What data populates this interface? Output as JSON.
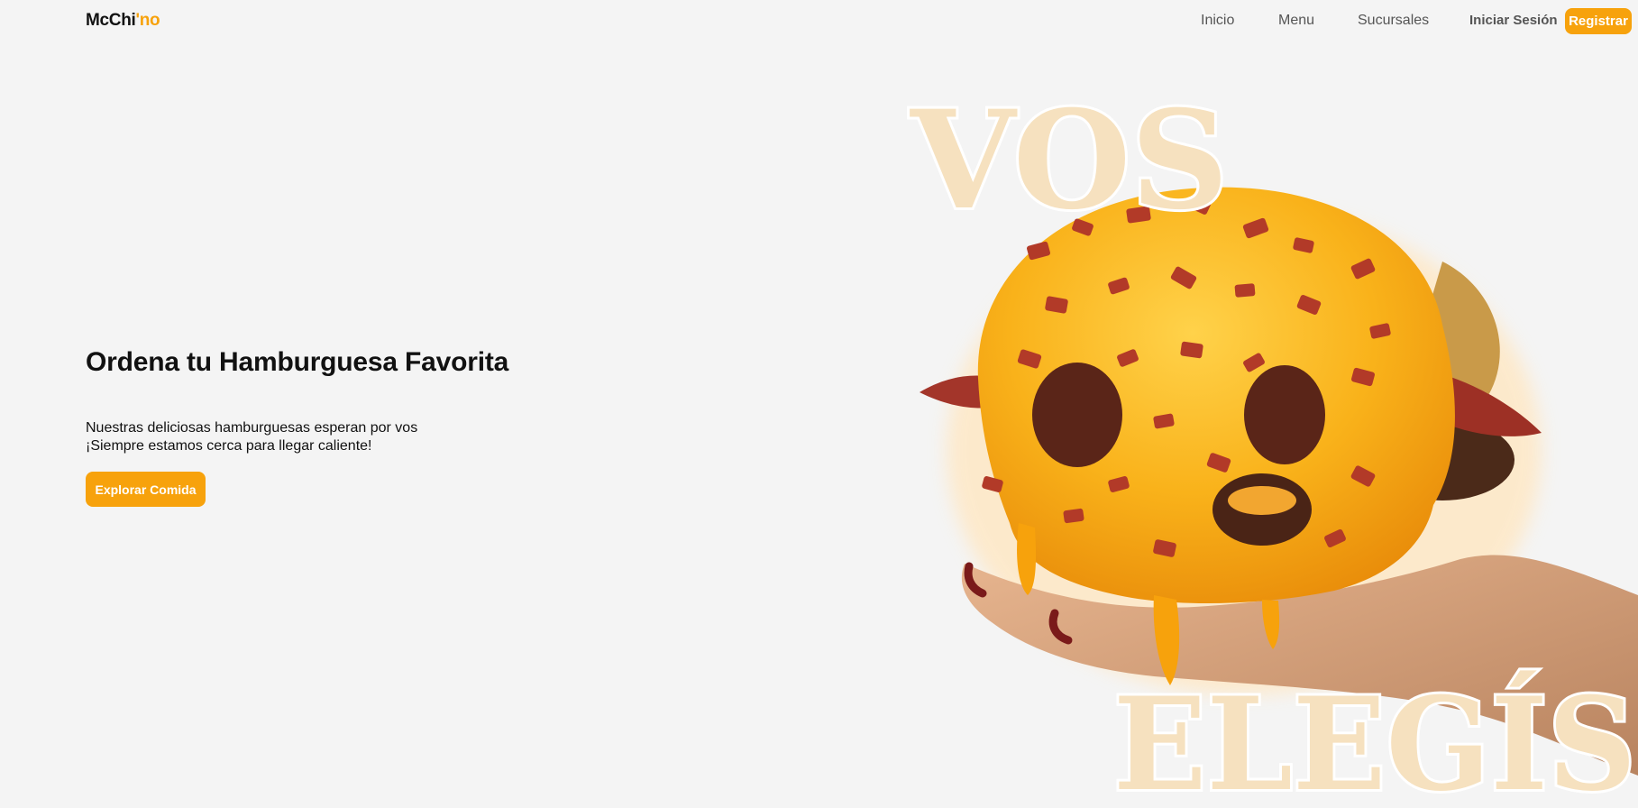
{
  "header": {
    "logo": {
      "main": "McChi",
      "accent": "'no"
    },
    "nav": [
      {
        "label": "Inicio"
      },
      {
        "label": "Menu"
      },
      {
        "label": "Sucursales"
      }
    ],
    "login_label": "Iniciar Sesión",
    "register_label": "Registrar"
  },
  "hero": {
    "title": "Ordena tu Hamburguesa Favorita",
    "description_line1": "Nuestras deliciosas hamburguesas esperan por vos",
    "description_line2": "¡Siempre estamos cerca para llegar caliente!",
    "cta_label": "Explorar Comida",
    "slogan_top": "VOS",
    "slogan_bottom": "ELEGÍS"
  },
  "colors": {
    "accent": "#f7a20c",
    "background": "#f4f4f4",
    "text": "#111111",
    "nav_text": "#555555"
  }
}
